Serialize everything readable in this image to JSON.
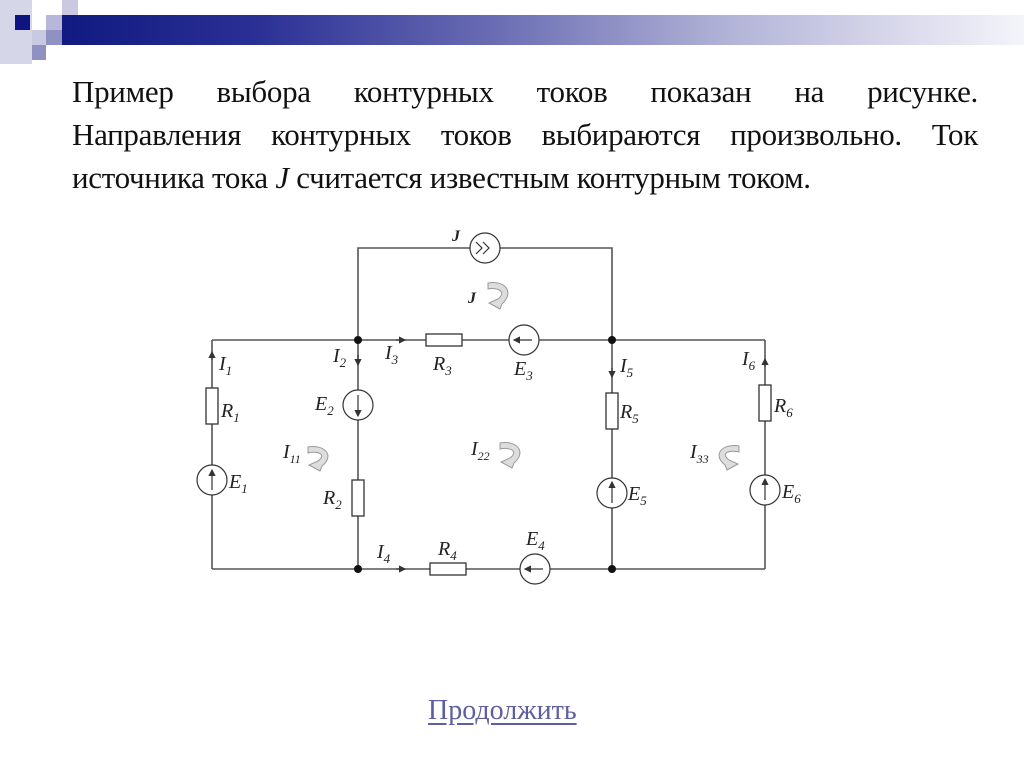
{
  "slide": {
    "paragraph_lines": [
      "Пример выбора контурных токов показан на рисунке.",
      "Направления контурных токов выбираются произвольно. Ток"
    ],
    "last_line_before": "источника тока ",
    "last_line_symbol": "J",
    "last_line_after": " считается известным контурным током.",
    "continue_link": "Продолжить"
  },
  "decoration": {
    "bar_colors": [
      "#101a80",
      "#f4f4fa"
    ],
    "square_colors": [
      "#0e1580",
      "#b7b8d9",
      "#8f91c2",
      "#d6d6e9"
    ]
  },
  "circuit": {
    "current_source": "J",
    "loop_J_label": "J",
    "labels": {
      "I1": {
        "main": "I",
        "sub": "1"
      },
      "I2": {
        "main": "I",
        "sub": "2"
      },
      "I3": {
        "main": "I",
        "sub": "3"
      },
      "I4": {
        "main": "I",
        "sub": "4"
      },
      "I5": {
        "main": "I",
        "sub": "5"
      },
      "I6": {
        "main": "I",
        "sub": "6"
      },
      "R1": {
        "main": "R",
        "sub": "1"
      },
      "R2": {
        "main": "R",
        "sub": "2"
      },
      "R3": {
        "main": "R",
        "sub": "3"
      },
      "R4": {
        "main": "R",
        "sub": "4"
      },
      "R5": {
        "main": "R",
        "sub": "5"
      },
      "R6": {
        "main": "R",
        "sub": "6"
      },
      "E1": {
        "main": "E",
        "sub": "1"
      },
      "E2": {
        "main": "E",
        "sub": "2"
      },
      "E3": {
        "main": "E",
        "sub": "3"
      },
      "E4": {
        "main": "E",
        "sub": "4"
      },
      "E5": {
        "main": "E",
        "sub": "5"
      },
      "E6": {
        "main": "E",
        "sub": "6"
      },
      "I11": {
        "main": "I",
        "sub": "11"
      },
      "I22": {
        "main": "I",
        "sub": "22"
      },
      "I33": {
        "main": "I",
        "sub": "33"
      }
    }
  }
}
